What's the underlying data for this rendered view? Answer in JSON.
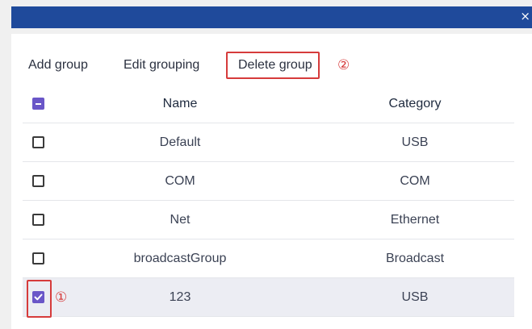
{
  "window": {
    "close_glyph": "×"
  },
  "toolbar": {
    "add_label": "Add group",
    "edit_label": "Edit grouping",
    "delete_label": "Delete group",
    "delete_marker": "②"
  },
  "table": {
    "columns": {
      "name": "Name",
      "category": "Category"
    },
    "header_checkbox_state": "indeterminate",
    "rows": [
      {
        "name": "Default",
        "category": "USB",
        "checked": false
      },
      {
        "name": "COM",
        "category": "COM",
        "checked": false
      },
      {
        "name": "Net",
        "category": "Ethernet",
        "checked": false
      },
      {
        "name": "broadcastGroup",
        "category": "Broadcast",
        "checked": false
      },
      {
        "name": "123",
        "category": "USB",
        "checked": true,
        "marker": "①"
      }
    ]
  },
  "colors": {
    "titlebar": "#1f4a9b",
    "accent": "#6a56c8",
    "annotation": "#d63b3b",
    "selected_row": "#ecedf3"
  }
}
